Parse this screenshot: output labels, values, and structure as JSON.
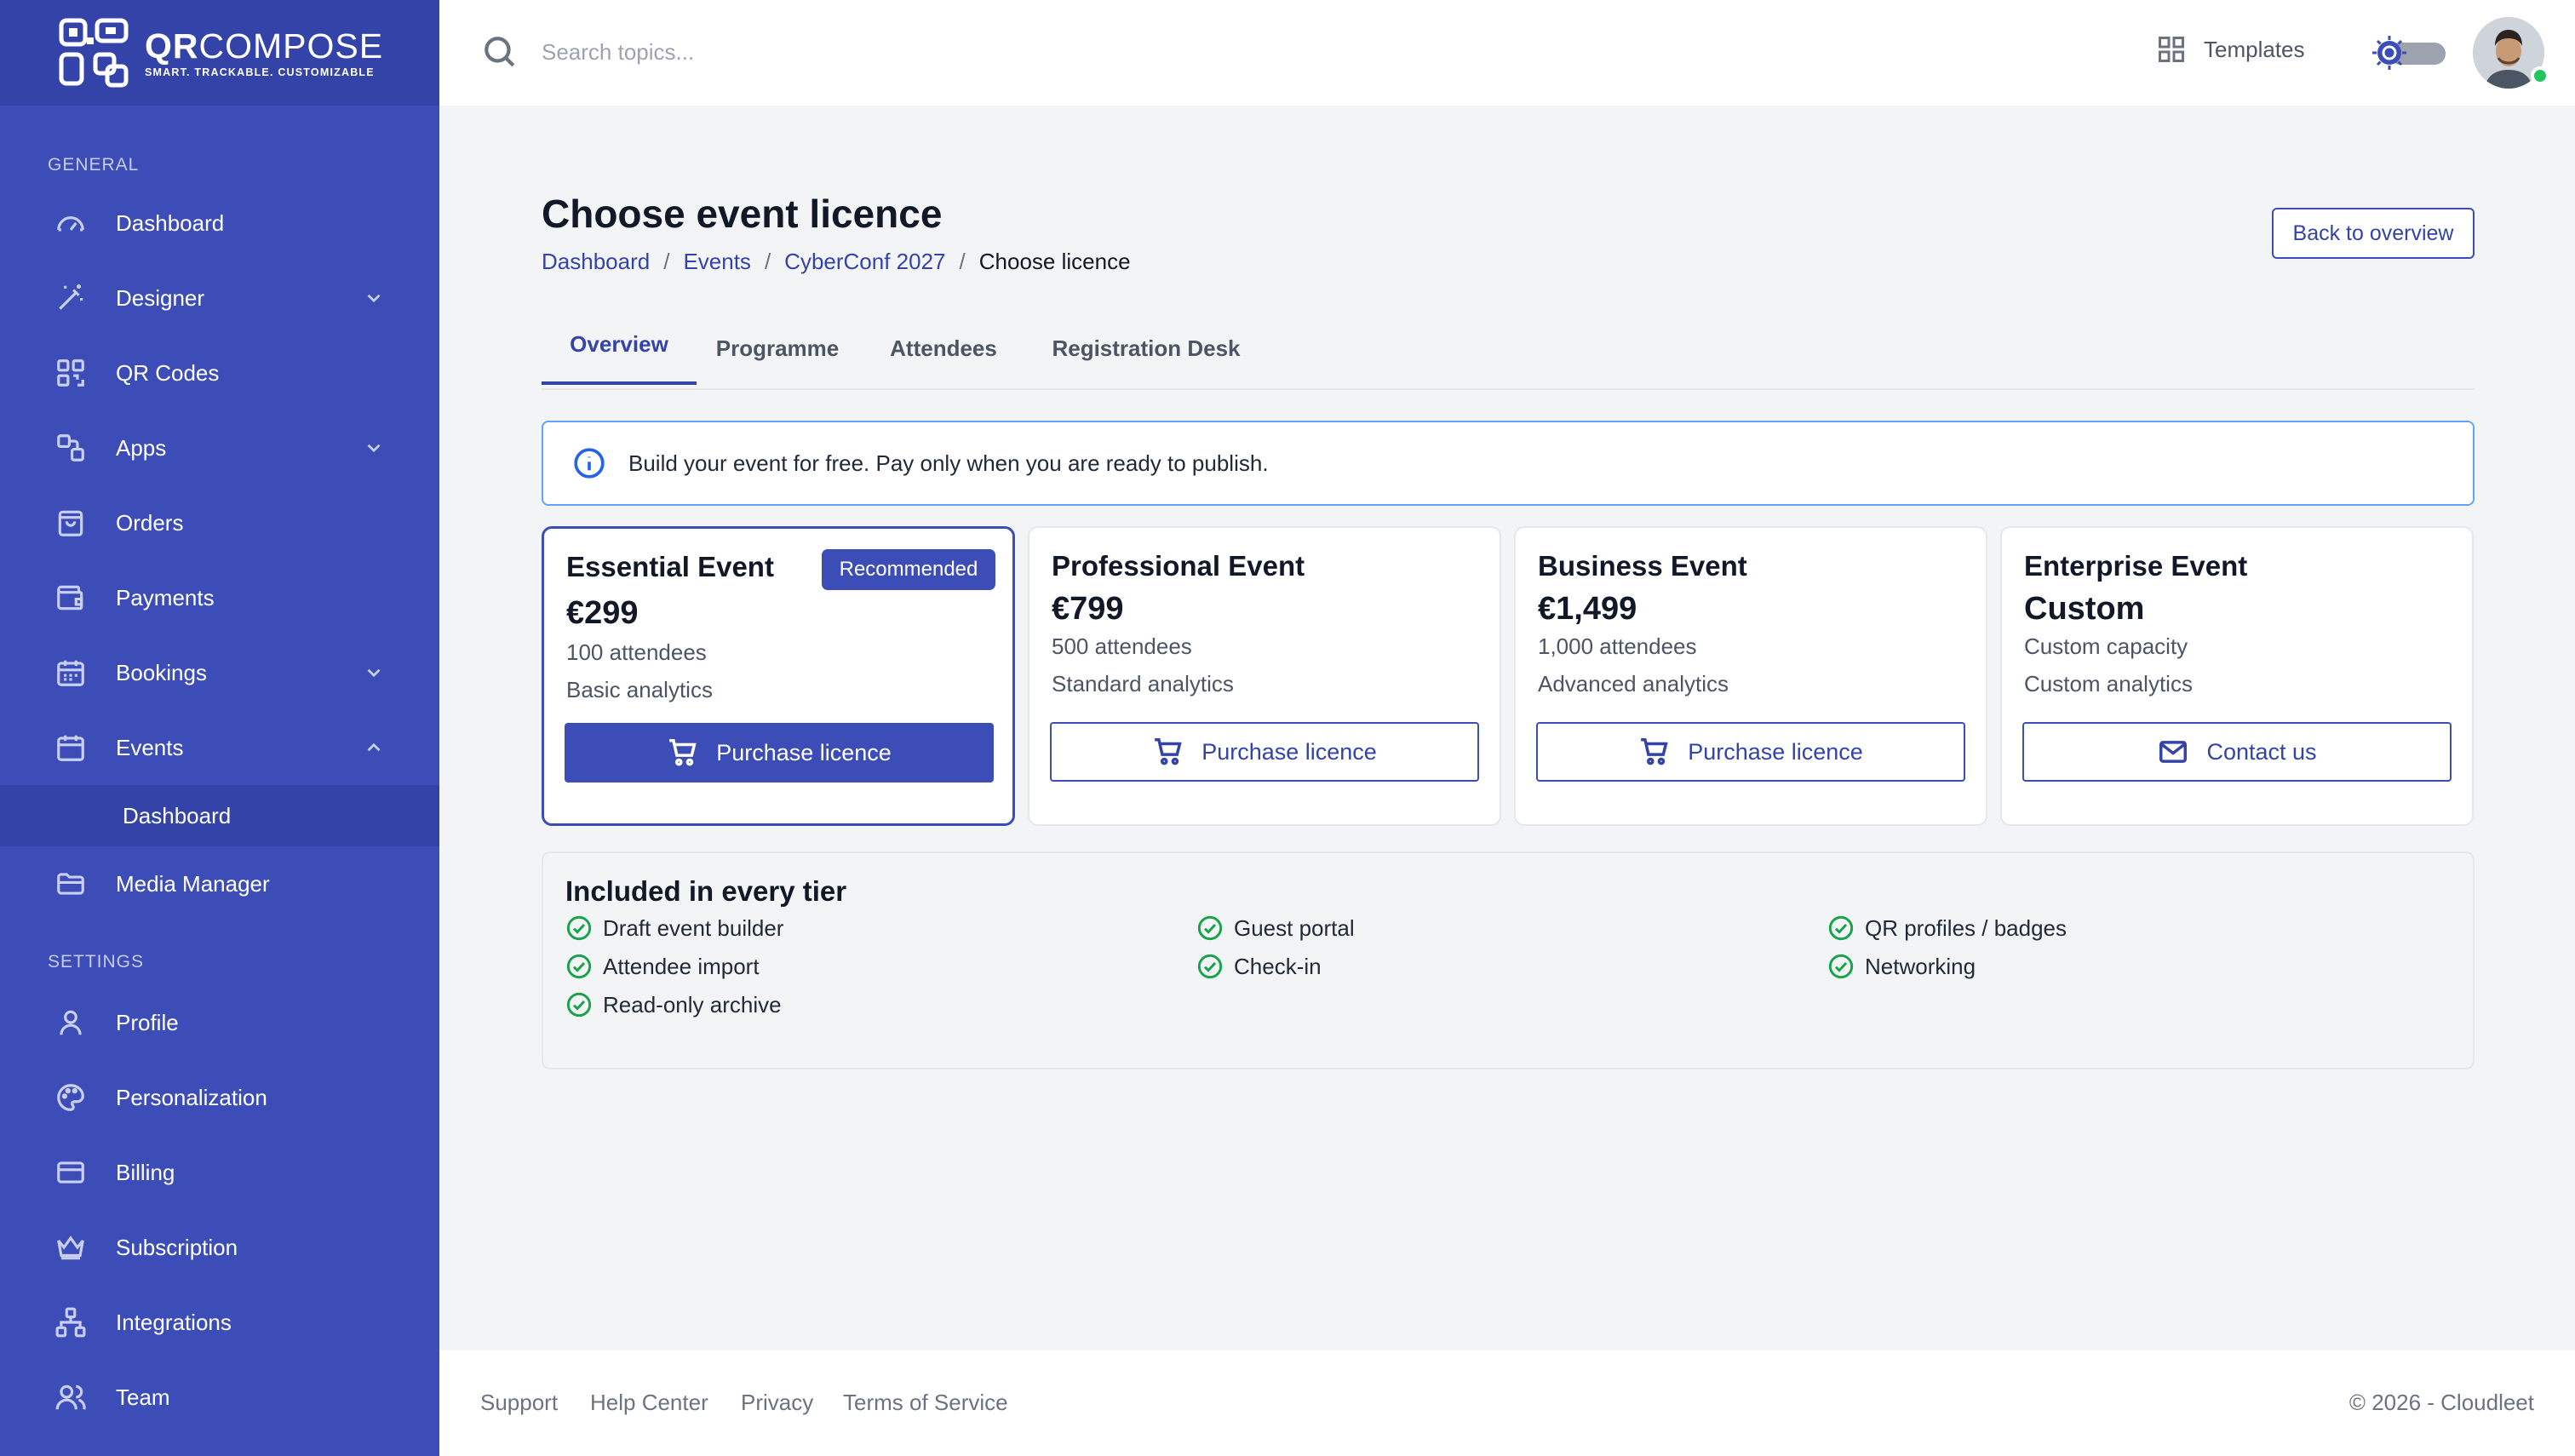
{
  "brand": {
    "name_part1": "QR",
    "name_part2": "COMPOSE",
    "tagline": "SMART. TRACKABLE. CUSTOMIZABLE"
  },
  "sidebar": {
    "general_label": "GENERAL",
    "settings_label": "SETTINGS",
    "items": [
      {
        "label": "Dashboard",
        "icon": "gauge-icon"
      },
      {
        "label": "Designer",
        "icon": "magic-wand-icon",
        "chevron": "down"
      },
      {
        "label": "QR Codes",
        "icon": "qr-code-icon"
      },
      {
        "label": "Apps",
        "icon": "apps-icon",
        "chevron": "down"
      },
      {
        "label": "Orders",
        "icon": "shopping-bag-icon"
      },
      {
        "label": "Payments",
        "icon": "wallet-icon"
      },
      {
        "label": "Bookings",
        "icon": "calendar-grid-icon",
        "chevron": "down"
      },
      {
        "label": "Events",
        "icon": "calendar-icon",
        "chevron": "up"
      },
      {
        "label": "Media Manager",
        "icon": "folder-icon"
      }
    ],
    "events_sub_item": "Dashboard",
    "settings_items": [
      {
        "label": "Profile",
        "icon": "user-icon"
      },
      {
        "label": "Personalization",
        "icon": "palette-icon"
      },
      {
        "label": "Billing",
        "icon": "credit-card-icon"
      },
      {
        "label": "Subscription",
        "icon": "crown-icon"
      },
      {
        "label": "Integrations",
        "icon": "network-icon"
      },
      {
        "label": "Team",
        "icon": "users-icon"
      }
    ]
  },
  "topbar": {
    "search_placeholder": "Search topics...",
    "templates_label": "Templates"
  },
  "page": {
    "title": "Choose event licence",
    "breadcrumb": [
      "Dashboard",
      "Events",
      "CyberConf 2027",
      "Choose licence"
    ],
    "back_button": "Back to overview",
    "tabs": [
      "Overview",
      "Programme",
      "Attendees",
      "Registration Desk"
    ],
    "active_tab": "Overview",
    "info_text": "Build your event for free. Pay only when you are ready to publish."
  },
  "plans": [
    {
      "name": "Essential Event",
      "price": "€299",
      "attendees": "100 attendees",
      "analytics": "Basic analytics",
      "badge": "Recommended",
      "button": "Purchase licence"
    },
    {
      "name": "Professional Event",
      "price": "€799",
      "attendees": "500 attendees",
      "analytics": "Standard analytics",
      "button": "Purchase licence"
    },
    {
      "name": "Business Event",
      "price": "€1,499",
      "attendees": "1,000 attendees",
      "analytics": "Advanced analytics",
      "button": "Purchase licence"
    },
    {
      "name": "Enterprise Event",
      "price": "Custom",
      "attendees": "Custom capacity",
      "analytics": "Custom analytics",
      "button": "Contact us"
    }
  ],
  "included": {
    "title": "Included in every tier",
    "features": [
      "Draft event builder",
      "Attendee import",
      "Read-only archive",
      "Guest portal",
      "Check-in",
      "QR profiles / badges",
      "Networking"
    ]
  },
  "footer": {
    "links": [
      "Support",
      "Help Center",
      "Privacy",
      "Terms of Service"
    ],
    "copyright": "© 2026 - Cloudleet"
  },
  "colors": {
    "sidebar": "#3d4db7",
    "sidebar_dark": "#3443a8",
    "accent": "#3443a8",
    "info_border": "#60a5fa",
    "success": "#16a34a"
  }
}
